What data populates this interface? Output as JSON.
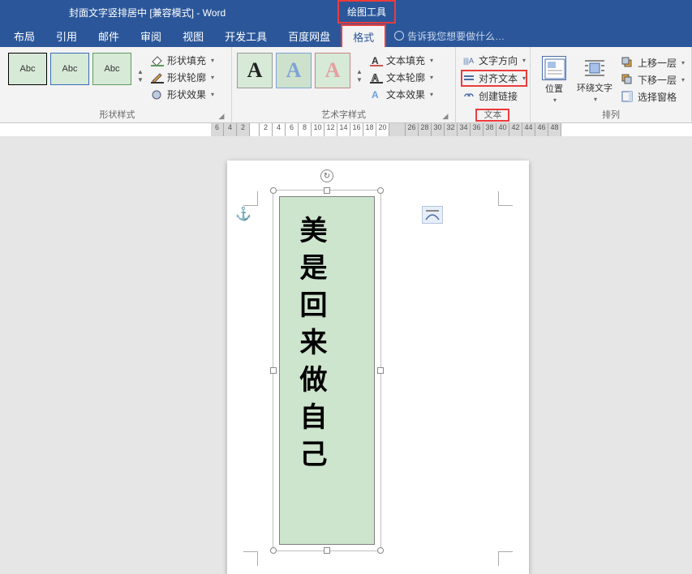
{
  "app_title": "封面文字竖排居中  [兼容模式] - Word",
  "contextual_tab": "绘图工具",
  "tabs": {
    "layout": "布局",
    "references": "引用",
    "mailings": "邮件",
    "review": "审阅",
    "view": "视图",
    "developer": "开发工具",
    "baidu": "百度网盘",
    "format": "格式"
  },
  "tell_me": "告诉我您想要做什么…",
  "groups": {
    "shape_styles": {
      "label": "形状样式",
      "thumb_text": "Abc",
      "fill": "形状填充",
      "outline": "形状轮廓",
      "effects": "形状效果"
    },
    "wordart_styles": {
      "label": "艺术字样式",
      "thumb_text": "A",
      "text_fill": "文本填充",
      "text_outline": "文本轮廓",
      "text_effects": "文本效果"
    },
    "text": {
      "label": "文本",
      "direction": "文字方向",
      "align": "对齐文本",
      "link": "创建链接"
    },
    "arrange": {
      "label": "排列",
      "position": "位置",
      "wrap": "环绕文字",
      "bring_forward": "上移一层",
      "send_backward": "下移一层",
      "selection_pane": "选择窗格"
    }
  },
  "ruler_left": [
    "6",
    "4",
    "2"
  ],
  "ruler_right": [
    "2",
    "4",
    "6",
    "8",
    "10",
    "12",
    "14",
    "16",
    "18",
    "20",
    "",
    "",
    "26",
    "28",
    "30",
    "32",
    "34",
    "36",
    "38",
    "40",
    "42",
    "44",
    "46",
    "48"
  ],
  "document_text": "美是回来做自己"
}
